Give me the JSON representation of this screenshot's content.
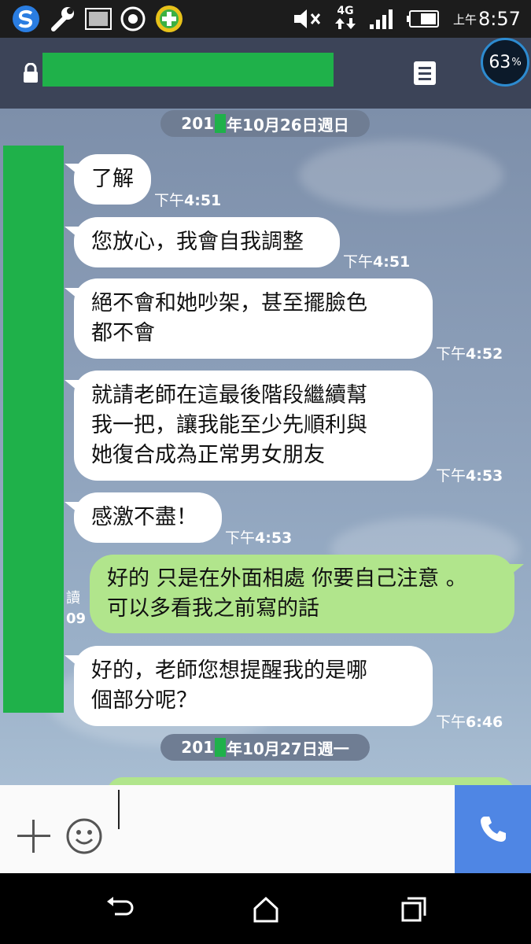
{
  "status_bar": {
    "network": "4G",
    "time_ampm": "上午",
    "time": "8:57",
    "icons": [
      "s-browser-icon",
      "wrench-icon",
      "gallery-icon",
      "record-icon",
      "plus-app-icon",
      "mute-icon",
      "network-4g-icon",
      "signal-icon",
      "battery-icon"
    ]
  },
  "header": {
    "battery_gauge": "63",
    "battery_unit": "%"
  },
  "chat": {
    "date1": {
      "prefix": "201",
      "suffix": "年10月26日週日"
    },
    "date2": {
      "prefix": "201",
      "suffix": "年10月27日週一"
    },
    "messages": [
      {
        "lines": [
          "了解"
        ],
        "ampm": "下午",
        "time": "4:51"
      },
      {
        "lines": [
          "您放心，我會自我調整"
        ],
        "ampm": "下午",
        "time": "4:51"
      },
      {
        "lines": [
          "絕不會和她吵架，甚至擺臉色",
          "都不會"
        ],
        "ampm": "下午",
        "time": "4:52"
      },
      {
        "lines": [
          "就請老師在這最後階段繼續幫",
          "我一把，讓我能至少先順利與",
          "她復合成為正常男女朋友"
        ],
        "ampm": "下午",
        "time": "4:53"
      },
      {
        "lines": [
          "感激不盡！"
        ],
        "ampm": "下午",
        "time": "4:53"
      },
      {
        "lines": [
          "好的，老師您想提醒我的是哪",
          "個部分呢？"
        ],
        "ampm": "下午",
        "time": "6:46"
      }
    ],
    "outgoing": {
      "lines": [
        "好的 只是在外面相處 你要自己注意 。",
        "可以多看我之前寫的話"
      ],
      "read_label": "讀",
      "time_fragment": "09"
    }
  },
  "colors": {
    "header_bg": "#3c4458",
    "outgoing_bubble": "#b1e58c",
    "incoming_bubble": "#ffffff",
    "redaction": "#1fb14a",
    "call_button": "#4f86e4"
  }
}
